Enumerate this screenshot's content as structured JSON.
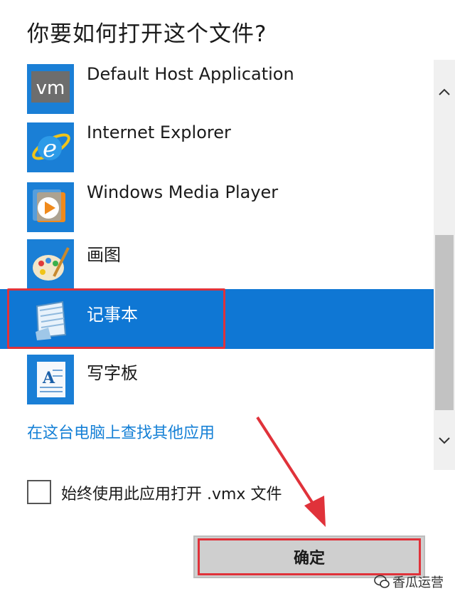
{
  "dialog": {
    "title": "你要如何打开这个文件?",
    "apps": [
      {
        "label": "Default Host Application",
        "icon": "vm-icon",
        "selected": false
      },
      {
        "label": "Internet Explorer",
        "icon": "internet-explorer-icon",
        "selected": false
      },
      {
        "label": "Windows Media Player",
        "icon": "media-player-icon",
        "selected": false
      },
      {
        "label": "画图",
        "icon": "paint-palette-icon",
        "selected": false
      },
      {
        "label": "记事本",
        "icon": "notepad-icon",
        "selected": true
      },
      {
        "label": "写字板",
        "icon": "wordpad-icon",
        "selected": false
      }
    ],
    "more_apps_link": "在这台电脑上查找其他应用",
    "always_use_label": "始终使用此应用打开 .vmx 文件",
    "always_use_checked": false,
    "ok_button_label": "确定",
    "vm_icon_text": "vm"
  },
  "watermark": {
    "text": "香瓜运营"
  },
  "colors": {
    "selection": "#0f77d4",
    "link": "#1580d6",
    "annotation": "#e0323a",
    "icon_bg": "#1a7fd6"
  }
}
